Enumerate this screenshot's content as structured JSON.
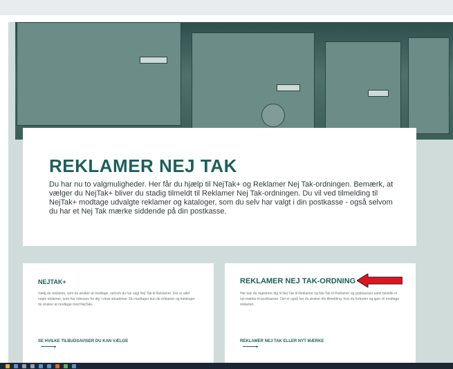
{
  "hero": {
    "title": "REKLAMER NEJ TAK",
    "text": "Du har nu to valgmuligheder. Her får du hjælp til NejTak+ og Reklamer Nej Tak-ordningen. Bemærk, at vælger du NejTak+ bliver du stadig tilmeldt til Reklamer Nej Tak-ordningen. Du vil ved tilmelding til NejTak+ modtage udvalgte reklamer og kataloger, som du selv har valgt i din postkasse - også selvom du har et Nej Tak mærke siddende på din postkasse."
  },
  "cards": [
    {
      "title": "NEJTAK+",
      "text": "Vælg de reklamer, som du ønsker at modtage, selvom du har sagt Nej Tak til Reklamer. Der er altid nogle reklamer, som har relevans for dig i visse situationer. Du modtager kun de reklamer og kataloger du ønsker at modtage med NejTak+",
      "link": "SE HVILKE TILBUDSAVISER DU KAN VÆLGE"
    },
    {
      "title": "REKLAMER NEJ TAK-ORDNING",
      "text": "Her kan du registrere dig til Nej Tak til Reklamer og Nej Tak til Reklamer og gratisaviser samt bestille et nyt mærke til postkassen. Det er også her du ønsker din tilmelding, hvis du fortryder og igen vil modtage reklamer.",
      "link": "REKLAMER NEJ TAK ELLER NYT MÆRKE"
    }
  ],
  "colors": {
    "brand_green": "#1d5f5a",
    "page_bg": "#cfdcda",
    "annotation_red": "#e0151b"
  }
}
